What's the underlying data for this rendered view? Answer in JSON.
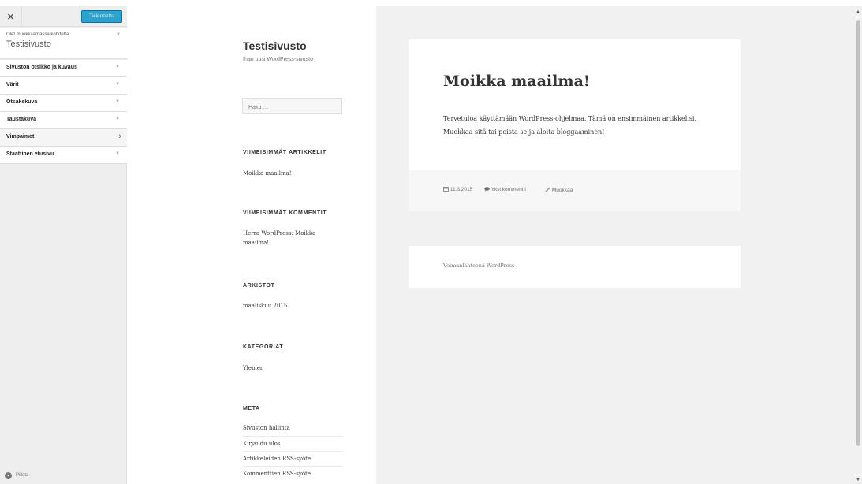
{
  "customizer": {
    "close_glyph": "×",
    "save_label": "Tallennettu",
    "info_pre": "Olet muokkaamassa kohdetta",
    "info_title": "Testisivusto",
    "sections": [
      {
        "label": "Sivuston otsikko ja kuvaus",
        "arrow": "▼"
      },
      {
        "label": "Värit",
        "arrow": "▼"
      },
      {
        "label": "Otsakekuva",
        "arrow": "▼"
      },
      {
        "label": "Taustakuva",
        "arrow": "▼"
      },
      {
        "label": "Vimpaimet",
        "arrow": "›"
      },
      {
        "label": "Staattinen etusivu",
        "arrow": "▼"
      }
    ],
    "footer_label": "Piilota",
    "info_arrow": "▼"
  },
  "site": {
    "title": "Testisivusto",
    "description": "Ihan uusi WordPress-sivusto",
    "search_placeholder": "Haku …",
    "widgets": {
      "recent_posts_title": "VIIMEISIMMÄT ARTIKKELIT",
      "recent_posts": [
        "Moikka maailma!"
      ],
      "recent_comments_title": "VIIMEISIMMÄT KOMMENTIT",
      "recent_comment_line1": "Herra WordPress: Moikka",
      "recent_comment_line2": "maailma!",
      "archives_title": "ARKISTOT",
      "archives": [
        "maaliskuu 2015"
      ],
      "categories_title": "KATEGORIAT",
      "categories": [
        "Yleinen"
      ],
      "meta_title": "META",
      "meta_links": [
        "Sivuston hallinta",
        "Kirjaudu ulos",
        "Artikkeleiden RSS-syöte",
        "Kommenttien RSS-syöte"
      ]
    }
  },
  "post": {
    "title": "Moikka maailma!",
    "body": "Tervetuloa käyttämään WordPress-ohjelmaa. Tämä on ensimmäinen artikkelisi. Muokkaa sitä tai poista se ja aloita bloggaaminen!",
    "date": "11.3.2015",
    "comments": "Yksi kommentti",
    "edit": "Muokkaa"
  },
  "footer": {
    "credit": "Voimanlähteenä WordPress"
  },
  "icons": {
    "calendar": "calendar-icon",
    "comment": "comment-icon",
    "edit": "pencil-icon"
  },
  "colors": {
    "save_button": "#2ea2cc",
    "content_bg": "#f1f1f1"
  }
}
